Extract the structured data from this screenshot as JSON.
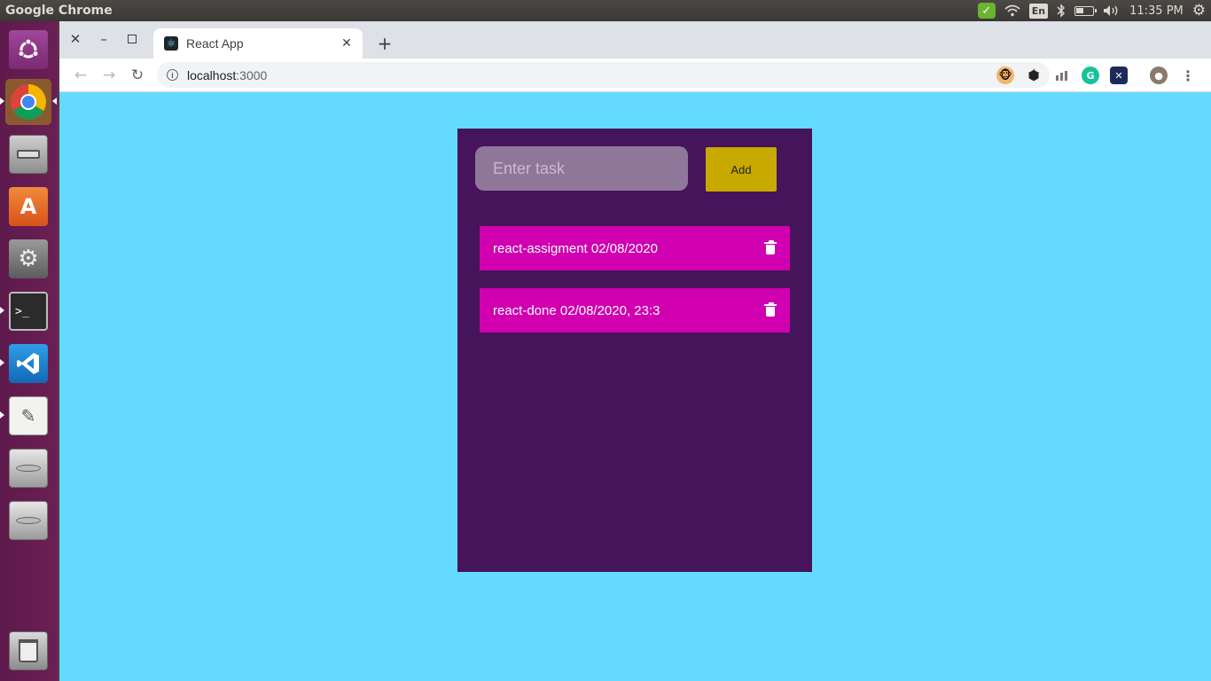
{
  "os": {
    "panel_title": "Google Chrome",
    "keyboard_layout": "En",
    "clock": "11:35 PM"
  },
  "launcher": {
    "items": [
      {
        "name": "ubuntu-dash",
        "icon": "ubuntu-logo-icon"
      },
      {
        "name": "google-chrome",
        "icon": "chrome-icon"
      },
      {
        "name": "files",
        "icon": "file-cabinet-icon"
      },
      {
        "name": "ubuntu-software",
        "icon": "shopping-bag-icon"
      },
      {
        "name": "system-settings",
        "icon": "wrench-gear-icon"
      },
      {
        "name": "terminal",
        "icon": "terminal-icon"
      },
      {
        "name": "vs-code",
        "icon": "vscode-icon"
      },
      {
        "name": "text-editor",
        "icon": "text-editor-icon"
      },
      {
        "name": "drive-1",
        "icon": "hard-drive-icon"
      },
      {
        "name": "drive-2",
        "icon": "hard-drive-icon"
      },
      {
        "name": "trash",
        "icon": "trash-icon"
      }
    ]
  },
  "browser": {
    "tab_title": "React App",
    "url_host": "localhost",
    "url_port": ":3000"
  },
  "app": {
    "input_placeholder": "Enter task",
    "add_label": "Add",
    "tasks": [
      {
        "text": "react-assigment  02/08/2020"
      },
      {
        "text": "react-done  02/08/2020, 23:3"
      }
    ]
  },
  "colors": {
    "page_background": "#64dafe",
    "panel": "#45145a",
    "input": "#8f7799",
    "add_button": "#c7a900",
    "task_item": "#d000b0"
  }
}
